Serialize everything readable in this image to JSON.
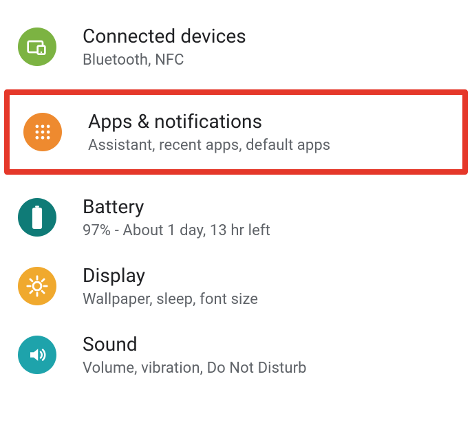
{
  "settings": {
    "items": [
      {
        "id": "connected-devices",
        "title": "Connected devices",
        "subtitle": "Bluetooth, NFC",
        "icon": "devices-icon",
        "color": "#7cb342",
        "highlighted": false
      },
      {
        "id": "apps-notifications",
        "title": "Apps & notifications",
        "subtitle": "Assistant, recent apps, default apps",
        "icon": "apps-icon",
        "color": "#ee8a2f",
        "highlighted": true
      },
      {
        "id": "battery",
        "title": "Battery",
        "subtitle": "97% - About 1 day, 13 hr left",
        "icon": "battery-icon",
        "color": "#0f7b77",
        "highlighted": false
      },
      {
        "id": "display",
        "title": "Display",
        "subtitle": "Wallpaper, sleep, font size",
        "icon": "display-icon",
        "color": "#f0a92e",
        "highlighted": false
      },
      {
        "id": "sound",
        "title": "Sound",
        "subtitle": "Volume, vibration, Do Not Disturb",
        "icon": "sound-icon",
        "color": "#1ea3ab",
        "highlighted": false
      }
    ]
  }
}
